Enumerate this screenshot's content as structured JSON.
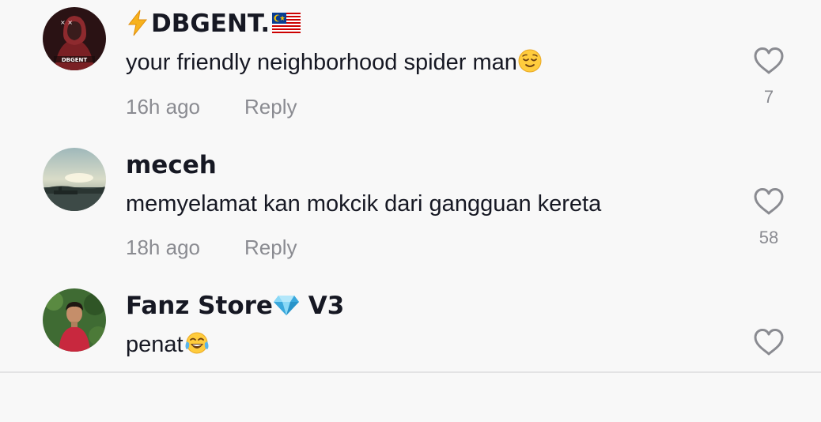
{
  "comments": [
    {
      "username": "DBGENT.",
      "text": "your friendly neighborhood spider man",
      "time": "16h ago",
      "reply_label": "Reply",
      "likes": "7",
      "avatar_label": "DBGENT"
    },
    {
      "username": "meceh",
      "text": "memyelamat kan mokcik dari gangguan kereta",
      "time": "18h ago",
      "reply_label": "Reply",
      "likes": "58"
    },
    {
      "username": "Fanz Store",
      "username_suffix": " V3",
      "text": "penat",
      "likes": ""
    }
  ],
  "icons": {
    "like": "heart-outline-icon",
    "lightning": "lightning-emoji",
    "flag": "malaysia-flag-emoji",
    "relieved": "relieved-face-emoji",
    "diamond": "gem-emoji",
    "laughing": "tears-of-joy-emoji"
  },
  "colors": {
    "background": "#f8f8f8",
    "text": "#161823",
    "secondary": "#8a8b91"
  }
}
